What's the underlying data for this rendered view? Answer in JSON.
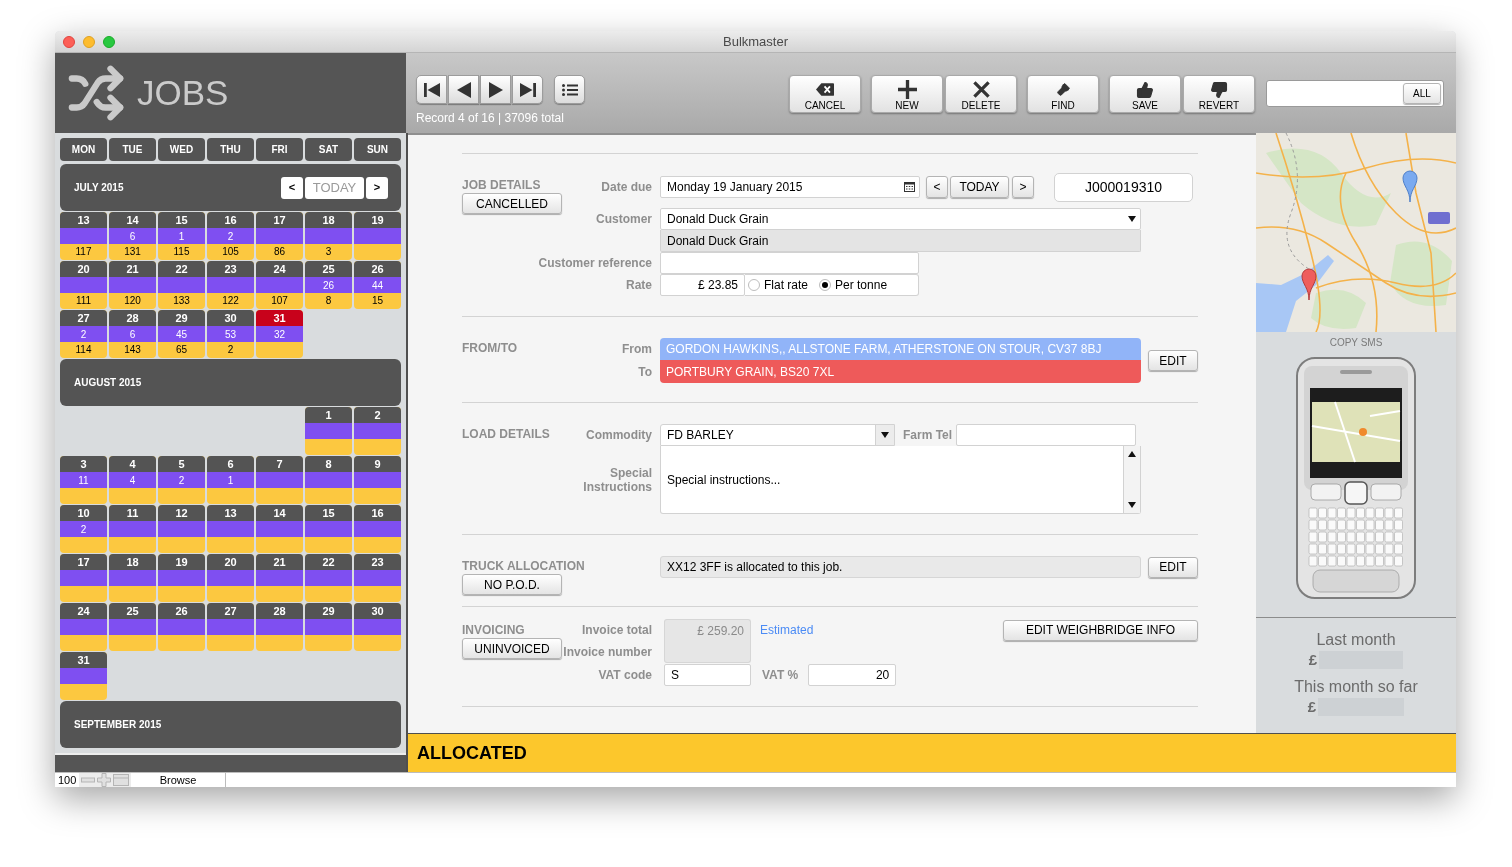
{
  "window": {
    "title": "Bulkmaster"
  },
  "header": {
    "title": "JOBS"
  },
  "calendar": {
    "weekdays": [
      "MON",
      "TUE",
      "WED",
      "THU",
      "FRI",
      "SAT",
      "SUN"
    ],
    "months": [
      {
        "title": "JULY 2015",
        "nav": {
          "prev": "<",
          "today": "TODAY",
          "next": ">"
        },
        "weeks": [
          [
            {
              "day": "13",
              "lower_count": "117",
              "today": false
            },
            {
              "day": "14",
              "upper_count": "6",
              "lower_count": "131",
              "today": false
            },
            {
              "day": "15",
              "upper_count": "1",
              "lower_count": "115",
              "today": false
            },
            {
              "day": "16",
              "upper_count": "2",
              "lower_count": "105",
              "today": false
            },
            {
              "day": "17",
              "lower_count": "86",
              "today": false
            },
            {
              "day": "18",
              "lower_count": "3",
              "today": false
            },
            {
              "day": "19",
              "today": false
            }
          ],
          [
            {
              "day": "20",
              "lower_count": "111",
              "today": false
            },
            {
              "day": "21",
              "lower_count": "120",
              "today": false
            },
            {
              "day": "22",
              "lower_count": "133",
              "today": false
            },
            {
              "day": "23",
              "lower_count": "122",
              "today": false
            },
            {
              "day": "24",
              "lower_count": "107",
              "today": false
            },
            {
              "day": "25",
              "upper_count": "26",
              "lower_count": "8",
              "today": false
            },
            {
              "day": "26",
              "upper_count": "44",
              "lower_count": "15",
              "today": false
            }
          ],
          [
            {
              "day": "27",
              "upper_count": "2",
              "lower_count": "114",
              "today": false
            },
            {
              "day": "28",
              "upper_count": "6",
              "lower_count": "143",
              "today": false
            },
            {
              "day": "29",
              "upper_count": "45",
              "lower_count": "65",
              "today": false
            },
            {
              "day": "30",
              "upper_count": "53",
              "lower_count": "2",
              "today": false
            },
            {
              "day": "31",
              "upper_count": "32",
              "today": true
            }
          ]
        ]
      },
      {
        "title": "AUGUST 2015",
        "weeks": [
          [
            {
              "day": "1",
              "today": false
            },
            {
              "day": "2",
              "today": false
            }
          ],
          [
            {
              "day": "3",
              "upper_count": "11",
              "today": false
            },
            {
              "day": "4",
              "upper_count": "4",
              "today": false
            },
            {
              "day": "5",
              "upper_count": "2",
              "today": false
            },
            {
              "day": "6",
              "upper_count": "1",
              "today": false
            },
            {
              "day": "7",
              "today": false
            },
            {
              "day": "8",
              "today": false
            },
            {
              "day": "9",
              "today": false
            }
          ],
          [
            {
              "day": "10",
              "upper_count": "2",
              "today": false
            },
            {
              "day": "11",
              "today": false
            },
            {
              "day": "12",
              "today": false
            },
            {
              "day": "13",
              "today": false
            },
            {
              "day": "14",
              "today": false
            },
            {
              "day": "15",
              "today": false
            },
            {
              "day": "16",
              "today": false
            }
          ],
          [
            {
              "day": "17",
              "today": false
            },
            {
              "day": "18",
              "today": false
            },
            {
              "day": "19",
              "today": false
            },
            {
              "day": "20",
              "today": false
            },
            {
              "day": "21",
              "today": false
            },
            {
              "day": "22",
              "today": false
            },
            {
              "day": "23",
              "today": false
            }
          ],
          [
            {
              "day": "24",
              "today": false
            },
            {
              "day": "25",
              "today": false
            },
            {
              "day": "26",
              "today": false
            },
            {
              "day": "27",
              "today": false
            },
            {
              "day": "28",
              "today": false
            },
            {
              "day": "29",
              "today": false
            },
            {
              "day": "30",
              "today": false
            }
          ],
          [
            {
              "day": "31",
              "today": false
            }
          ]
        ]
      },
      {
        "title": "SEPTEMBER 2015"
      }
    ]
  },
  "toolbar": {
    "record_info": "Record 4 of 16 | 37096 total",
    "action_groups": [
      [
        {
          "kind": "cancel",
          "label": "CANCEL"
        }
      ],
      [
        {
          "kind": "new",
          "label": "NEW"
        },
        {
          "kind": "delete",
          "label": "DELETE"
        }
      ],
      [
        {
          "kind": "find",
          "label": "FIND"
        }
      ],
      [
        {
          "kind": "save",
          "label": "SAVE"
        },
        {
          "kind": "revert",
          "label": "REVERT"
        }
      ]
    ],
    "search": {
      "button": "ALL"
    }
  },
  "job_details": {
    "title": "JOB DETAILS",
    "status": "CANCELLED",
    "date_due": {
      "label": "Date due",
      "value": "Monday 19 January 2015"
    },
    "date_nav": {
      "prev": "<",
      "today": "TODAY",
      "next": ">"
    },
    "job_number": "J000019310",
    "customer": {
      "label": "Customer",
      "value": "Donald Duck Grain",
      "expanded": true,
      "options": [
        "Donald Duck Grain"
      ]
    },
    "customer_reference": {
      "label": "Customer reference"
    },
    "rate": {
      "label": "Rate",
      "value": "£ 23.85",
      "options": [
        {
          "label": "Flat rate",
          "selected": false
        },
        {
          "label": "Per tonne",
          "selected": true
        }
      ]
    }
  },
  "from_to": {
    "title": "FROM/TO",
    "from": {
      "label": "From",
      "value": "GORDON HAWKINS,, ALLSTONE FARM, ATHERSTONE ON STOUR, CV37 8BJ"
    },
    "to": {
      "label": "To",
      "value": "PORTBURY GRAIN, BS20 7XL"
    },
    "edit": "EDIT"
  },
  "load_details": {
    "title": "LOAD DETAILS",
    "commodity": {
      "label": "Commodity",
      "value": "FD BARLEY"
    },
    "farm_tel": {
      "label": "Farm Tel"
    },
    "special_instructions": {
      "label": "Special Instructions",
      "value": "Special instructions..."
    }
  },
  "truck_allocation": {
    "title": "TRUCK ALLOCATION",
    "status": "NO P.O.D.",
    "value": "XX12 3FF is allocated to this job.",
    "edit": "EDIT"
  },
  "invoicing": {
    "title": "INVOICING",
    "status": "UNINVOICED",
    "invoice_total": {
      "label": "Invoice total",
      "value": "£ 259.20",
      "disabled": true,
      "note": "Estimated"
    },
    "invoice_number": {
      "label": "Invoice number",
      "disabled": true
    },
    "vat_code": {
      "label": "VAT code",
      "value": "S"
    },
    "vat_percent": {
      "label": "VAT %",
      "value": "20"
    },
    "weighbridge": "EDIT WEIGHBRIDGE INFO"
  },
  "status": {
    "label": "ALLOCATED"
  },
  "side_panel": {
    "copy_sms": "COPY SMS",
    "last_month": {
      "label": "Last month",
      "currency": "£"
    },
    "this_month": {
      "label": "This month so far",
      "currency": "£"
    }
  },
  "footer": {
    "zoom": "100",
    "mode": "Browse"
  }
}
